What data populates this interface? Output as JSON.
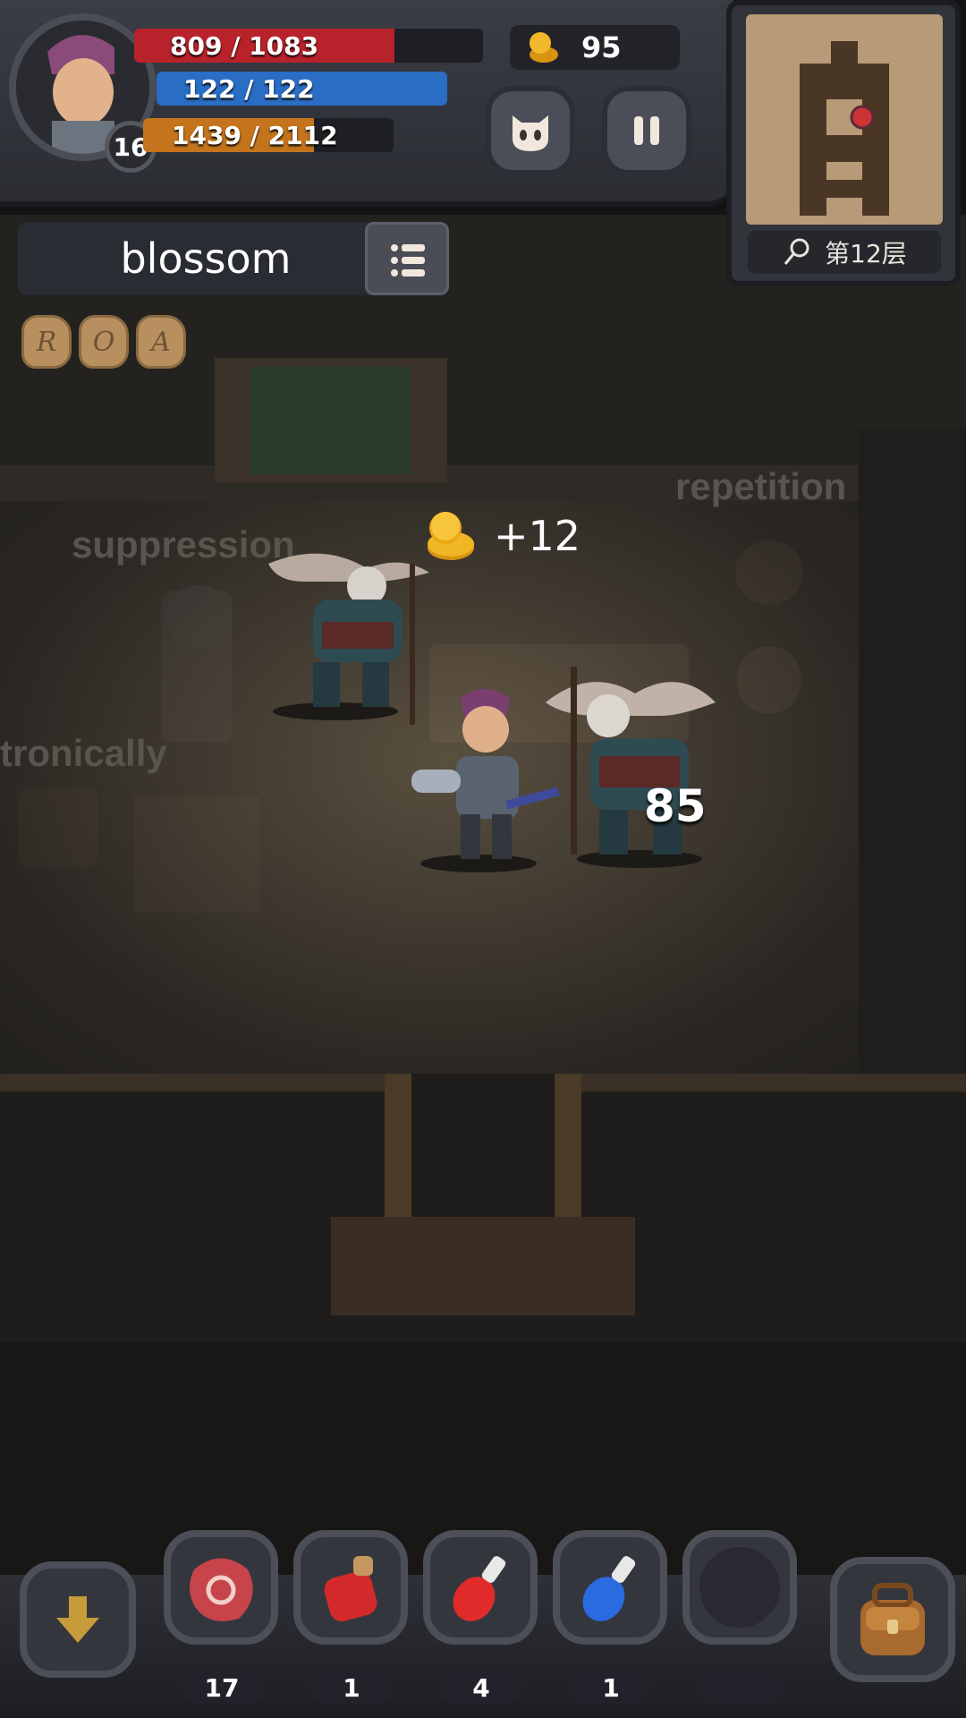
{
  "hud": {
    "level": "16",
    "hp": {
      "text": "809 / 1083",
      "ratio": 0.747,
      "color": "#b8222a"
    },
    "mp": {
      "text": "122 / 122",
      "ratio": 1.0,
      "color": "#2a6dc4"
    },
    "xp": {
      "text": "1439 / 2112",
      "ratio": 0.681,
      "color": "#c4741c"
    },
    "gold": "95"
  },
  "buttons": {
    "character_icon": "ghost-face-icon",
    "pause_icon": "pause-icon"
  },
  "minimap": {
    "floor_label": "第12层"
  },
  "word_challenge": {
    "word": "blossom",
    "runes": [
      "R",
      "O",
      "A"
    ]
  },
  "scene": {
    "floating_words": [
      "repetition",
      "suppression",
      "tronically"
    ],
    "coin_gain": "+12",
    "damage": "85"
  },
  "inventory": {
    "slots": [
      {
        "name": "meat-icon",
        "count": "17"
      },
      {
        "name": "large-red-potion-icon",
        "count": "1"
      },
      {
        "name": "red-potion-icon",
        "count": "4"
      },
      {
        "name": "blue-potion-icon",
        "count": "1"
      },
      {
        "name": "empty-slot-icon",
        "count": ""
      }
    ]
  }
}
